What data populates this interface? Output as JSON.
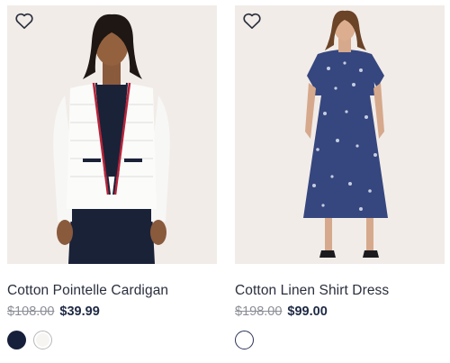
{
  "products": [
    {
      "name": "Cotton Pointelle Cardigan",
      "original_price": "$108.00",
      "sale_price": "$39.99",
      "swatches": [
        "navy",
        "white"
      ],
      "wishlist_icon": "heart-outline-icon"
    },
    {
      "name": "Cotton Linen Shirt Dress",
      "original_price": "$198.00",
      "sale_price": "$99.00",
      "swatches": [
        "navy-print"
      ],
      "wishlist_icon": "heart-outline-icon"
    }
  ],
  "colors": {
    "image_background": "#f1ece8",
    "text_primary": "#1f2a44",
    "text_strikethrough": "#8d8f96",
    "swatch_navy": "#17203a",
    "swatch_white": "#f6f5f2"
  }
}
